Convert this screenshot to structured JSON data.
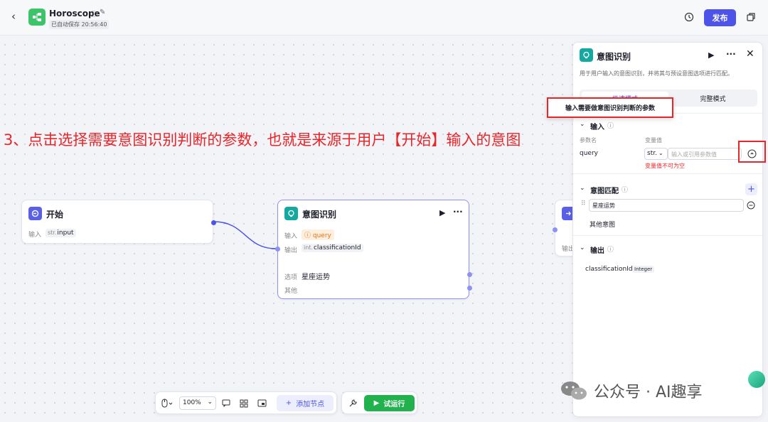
{
  "header": {
    "app_title": "Horoscope",
    "autosave_text": "已自动保存 20:56:40",
    "publish_label": "发布"
  },
  "annotation_text": "3、点击选择需要意图识别判断的参数，也就是来源于用户【开始】输入的意图",
  "tooltip_text": "输入需要做意图识别判断的参数",
  "start_node": {
    "title": "开始",
    "input_label": "输入",
    "param_type": "str.",
    "param_name": "input"
  },
  "intent_node": {
    "title": "意图识别",
    "input_label": "输入",
    "input_value": "query",
    "output_label": "输出",
    "output_type": "int.",
    "output_name": "classificationId",
    "option_label": "选项",
    "option_value": "星座运势",
    "other_label": "其他"
  },
  "partial_node": {
    "output_label": "输出"
  },
  "panel": {
    "title": "意图识别",
    "description": "用于用户输入的意图识别，并将其与预设意图选项进行匹配。",
    "tab_quick": "极速模式",
    "tab_full": "完整模式",
    "input_section": "输入",
    "col_name": "参数名",
    "col_value": "变量值",
    "param_name": "query",
    "param_type": "str.",
    "value_placeholder": "输入或引用参数值",
    "error_text": "变量值不可为空",
    "match_section": "意图匹配",
    "intent_option": "星座运势",
    "other_intent": "其他意图",
    "output_section": "输出",
    "output_name": "classificationId",
    "output_type": "Integer"
  },
  "toolbar": {
    "zoom": "100%",
    "add_node": "添加节点",
    "run": "试运行"
  },
  "watermark": "公众号 · AI趣享",
  "colors": {
    "accent": "#4d53e8",
    "annotation_red": "#e8262a",
    "run_green": "#21b14d",
    "intent_teal": "#13a8a0"
  }
}
